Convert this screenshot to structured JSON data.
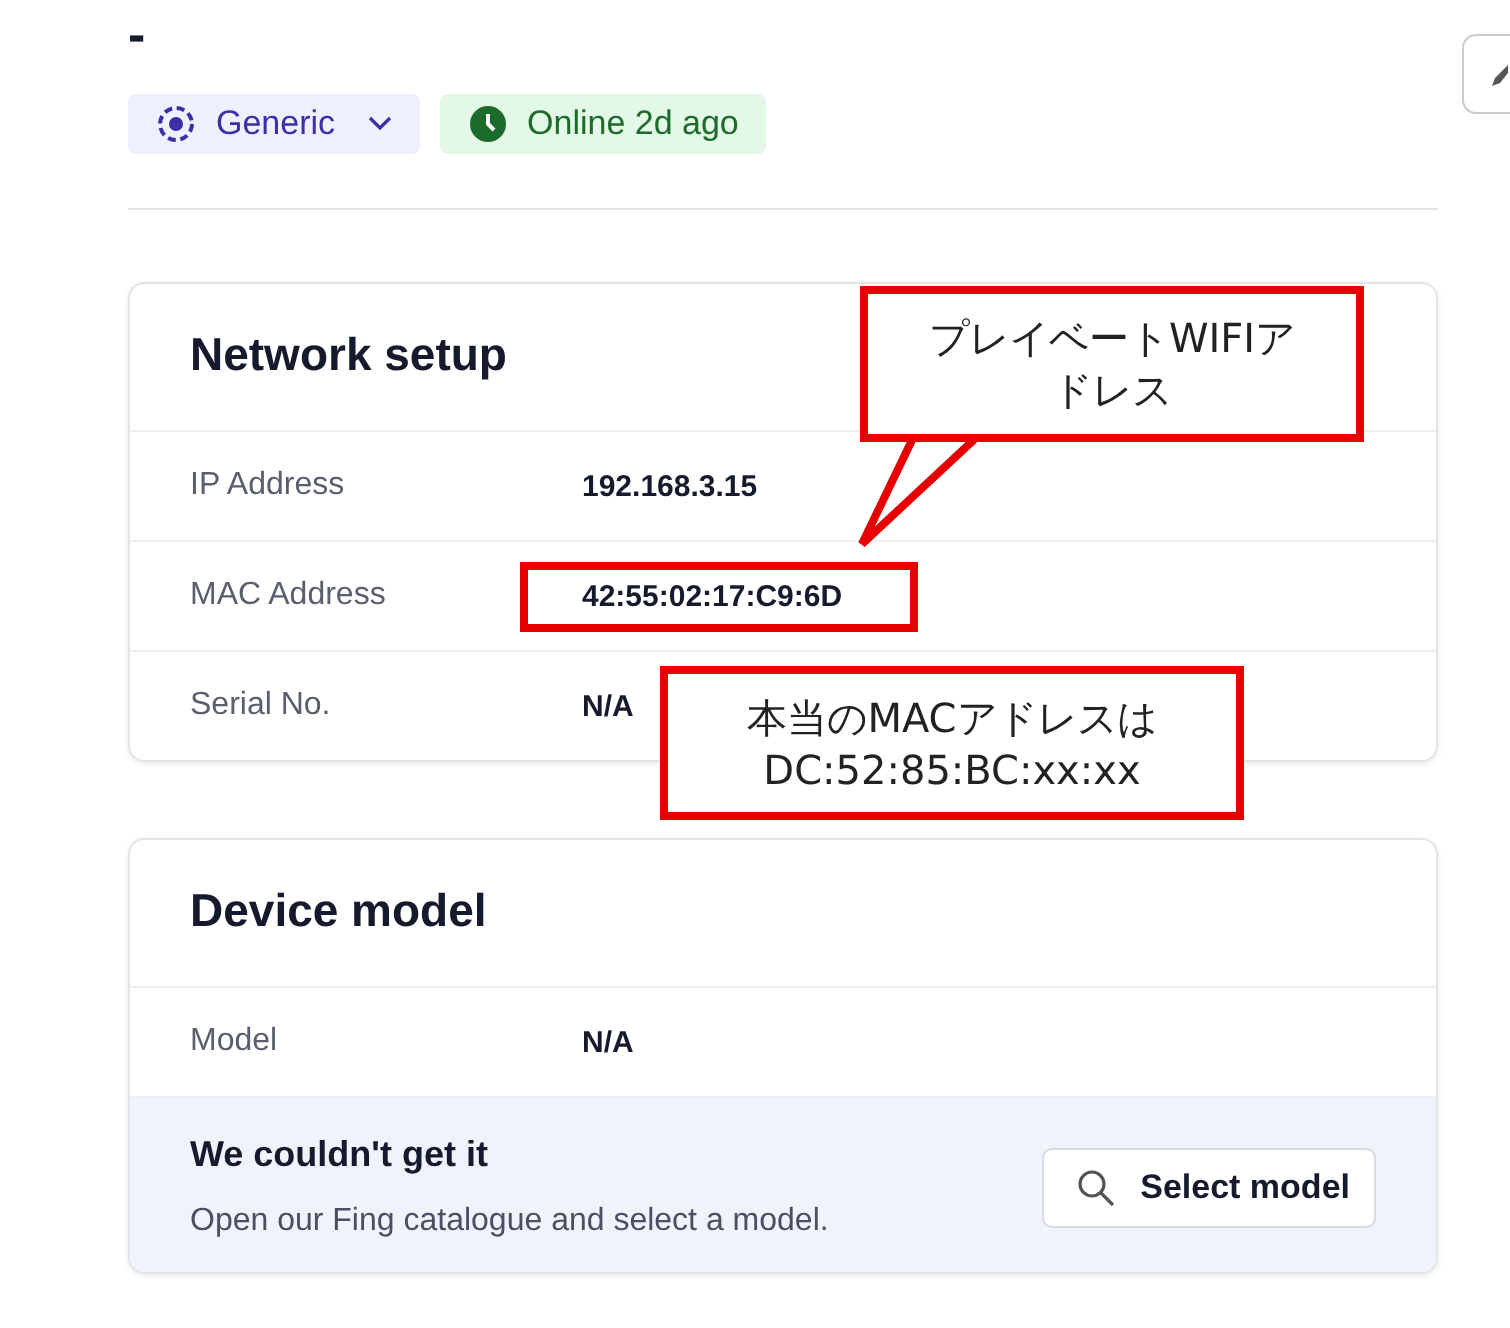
{
  "header": {
    "title": "-",
    "type_chip": {
      "label": "Generic"
    },
    "status_chip": {
      "label": "Online 2d ago"
    }
  },
  "network_setup": {
    "title": "Network setup",
    "rows": [
      {
        "label": "IP Address",
        "value": "192.168.3.15",
        "highlighted": false
      },
      {
        "label": "MAC Address",
        "value": "42:55:02:17:C9:6D",
        "highlighted": true
      },
      {
        "label": "Serial No.",
        "value": "N/A",
        "highlighted": false
      }
    ]
  },
  "device_model": {
    "title": "Device model",
    "rows": [
      {
        "label": "Model",
        "value": "N/A",
        "highlighted": false
      }
    ],
    "notice": {
      "title": "We couldn't get it",
      "text": "Open our Fing catalogue and select a model.",
      "button": "Select model"
    }
  },
  "annotations": [
    {
      "text": "プレイベートWIFIアドレス"
    },
    {
      "text": "本当のMACアドレスは\nDC:52:85:BC:xx:xx"
    }
  ]
}
